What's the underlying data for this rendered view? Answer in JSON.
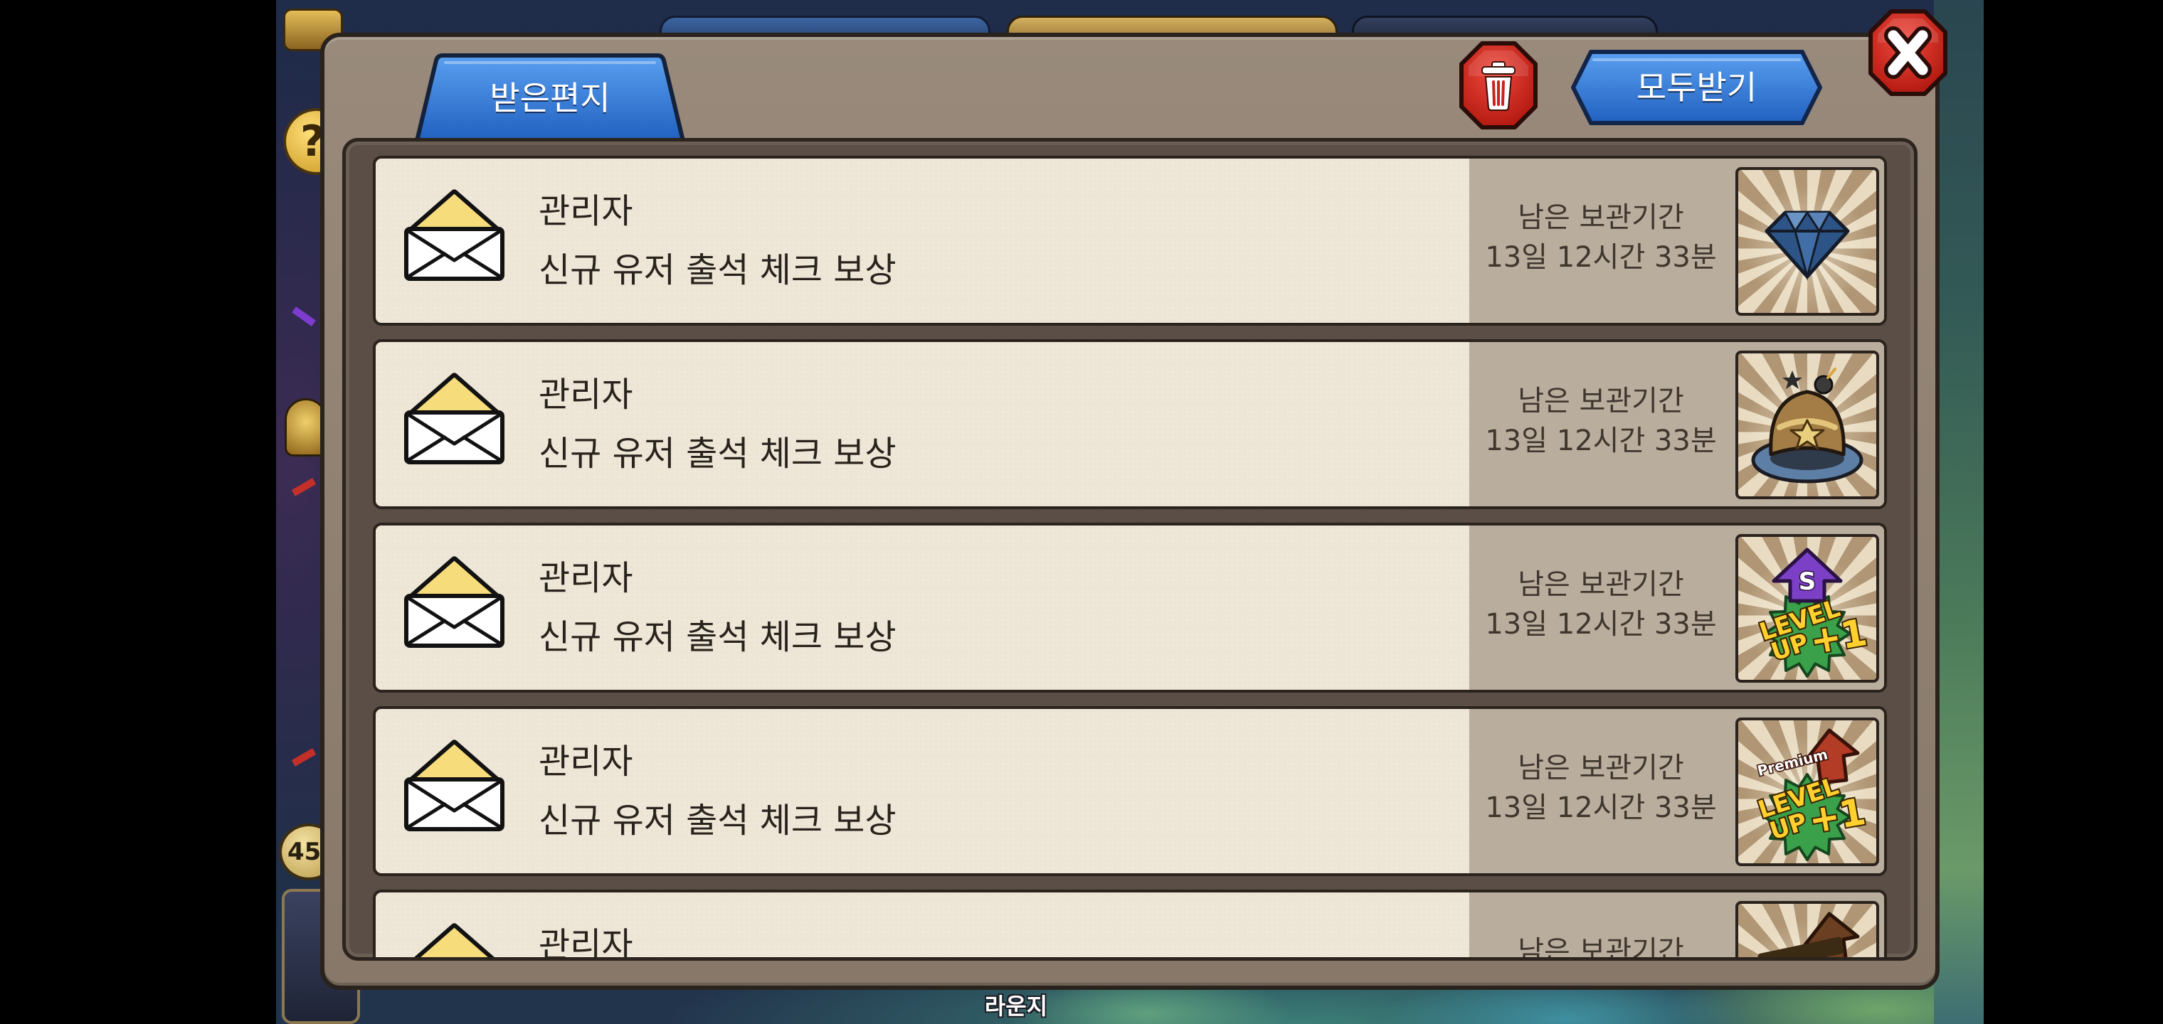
{
  "mailbox": {
    "tab_label": "받은편지",
    "receive_all_label": "모두받기",
    "delete_icon": "trash-icon",
    "close_icon": "close-icon",
    "mail_icon": "open-envelope-icon",
    "mails": [
      {
        "sender": "관리자",
        "subject": "신규 유저 출석 체크 보상",
        "remaining_label": "남은 보관기간",
        "remaining_time": "13일 12시간 33분",
        "reward_icon": "diamond-icon"
      },
      {
        "sender": "관리자",
        "subject": "신규 유저 출석 체크 보상",
        "remaining_label": "남은 보관기간",
        "remaining_time": "13일 12시간 33분",
        "reward_icon": "helmet-icon"
      },
      {
        "sender": "관리자",
        "subject": "신규 유저 출석 체크 보상",
        "remaining_label": "남은 보관기간",
        "remaining_time": "13일 12시간 33분",
        "reward_icon": "level-up-s-icon",
        "reward_text": {
          "badge": "S",
          "line1": "LEVEL",
          "line2": "UP",
          "bonus": "+1"
        }
      },
      {
        "sender": "관리자",
        "subject": "신규 유저 출석 체크 보상",
        "remaining_label": "남은 보관기간",
        "remaining_time": "13일 12시간 33분",
        "reward_icon": "premium-level-up-icon",
        "reward_text": {
          "badge": "Premium",
          "line1": "LEVEL",
          "line2": "UP",
          "bonus": "+1"
        }
      },
      {
        "sender": "관리자",
        "remaining_label": "남은 보관기간",
        "reward_icon": "level-up-icon"
      }
    ]
  },
  "background": {
    "help_icon": "question-icon",
    "level_badge": "45",
    "lounge_label": "라운지"
  },
  "colors": {
    "tab_blue": "#2f6fcf",
    "button_red": "#d42b22",
    "frame": "#8b7c6e",
    "list_background": "#5a4e46",
    "mail_background": "#eee7d8",
    "expiry_background": "#b9ad9d",
    "text_dark": "#2a231d"
  }
}
